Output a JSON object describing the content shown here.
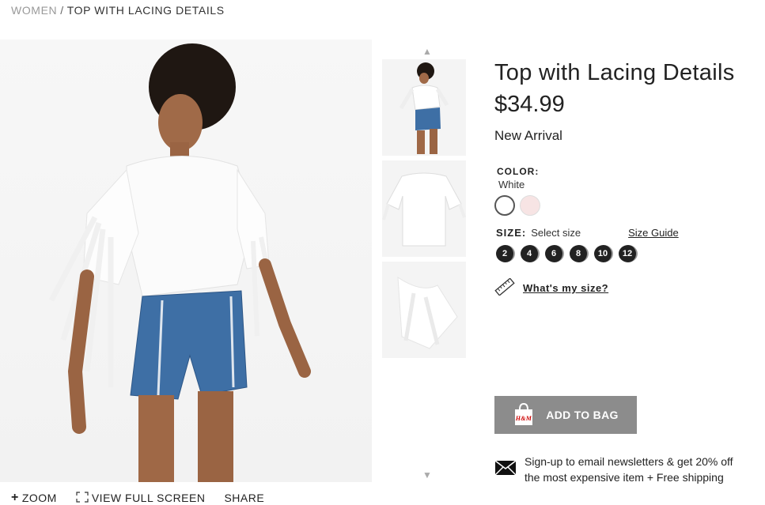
{
  "breadcrumb": {
    "parent": "WOMEN",
    "separator": "/",
    "current": "TOP WITH LACING DETAILS"
  },
  "product": {
    "title": "Top with Lacing Details",
    "price": "$34.99",
    "badge": "New Arrival",
    "color_label": "COLOR:",
    "color_value": "White",
    "colors": [
      "#ffffff",
      "#f7e4e4"
    ],
    "size_label": "SIZE:",
    "size_placeholder": "Select size",
    "size_guide": "Size Guide",
    "sizes": [
      "2",
      "4",
      "6",
      "8",
      "10",
      "12"
    ],
    "whats_my_size": "What's my size?",
    "add_to_bag": "ADD TO BAG",
    "bag_logo": "H&M"
  },
  "image_actions": {
    "zoom": "ZOOM",
    "full_screen": "VIEW FULL SCREEN",
    "share": "SHARE"
  },
  "newsletter": {
    "line1": "Sign-up to email newsletters & get 20% off",
    "line2": "the most expensive item + Free shipping"
  },
  "icons": {
    "zoom": "plus-icon",
    "full_screen": "expand-icon",
    "ruler": "ruler-icon",
    "envelope": "envelope-icon",
    "bag": "shopping-bag-icon",
    "up": "chevron-up-icon",
    "down": "chevron-down-icon"
  },
  "colors": {
    "button": "#8c8c8c",
    "text": "#222222",
    "breadcrumb_muted": "#999999"
  }
}
